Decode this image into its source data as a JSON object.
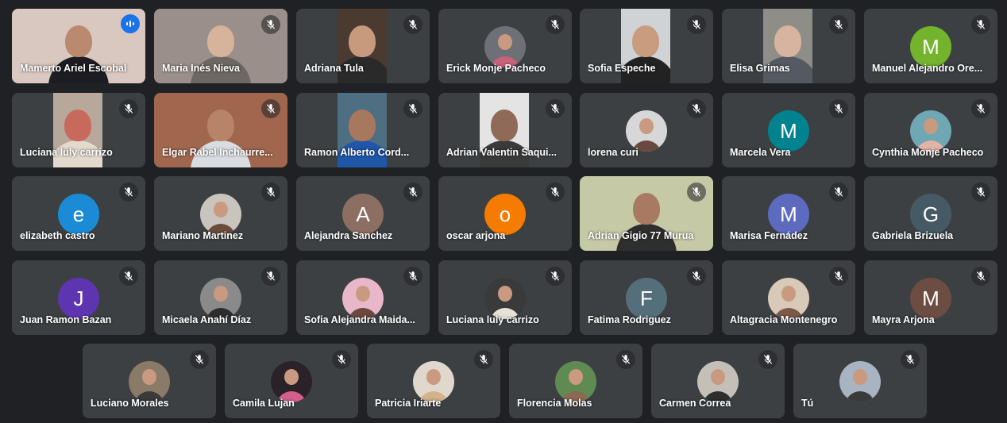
{
  "colors": {
    "background": "#202124",
    "tile": "#3c4043",
    "speaking_border": "#8ab4f8",
    "speaking_badge": "#1a73e8"
  },
  "participants": [
    {
      "name": "Mamerto Ariel Escobal",
      "kind": "video",
      "speaking": true,
      "muted": false,
      "video_bg": "#d9c8c0",
      "video_skin": "#b98a6e",
      "video_cloth": "#1c1c22"
    },
    {
      "name": "Maria Inés Nieva",
      "kind": "video",
      "muted": true,
      "video_bg": "#9a8f8a",
      "video_skin": "#d8b39b",
      "video_cloth": "#6e6863"
    },
    {
      "name": "Adriana Tula",
      "kind": "video",
      "muted": true,
      "video_bg": "#4a3a30",
      "video_skin": "#c79a7e",
      "video_cloth": "#2a2a2a"
    },
    {
      "name": "Erick Monje Pacheco",
      "kind": "photo",
      "muted": true,
      "photo_bg": "#6e7078",
      "photo_fg": "#c8627a"
    },
    {
      "name": "Sofia Espeche",
      "kind": "video",
      "muted": true,
      "video_bg": "#cfd3d6",
      "video_skin": "#c99c80",
      "video_cloth": "#222222"
    },
    {
      "name": "Elisa Grimas",
      "kind": "video",
      "muted": true,
      "video_bg": "#8f8d88",
      "video_skin": "#d6b4a0",
      "video_cloth": "#555a62"
    },
    {
      "name": "Manuel Alejandro Ore...",
      "kind": "letter",
      "muted": true,
      "letter": "M",
      "avatar_color": "#74b32c"
    },
    {
      "name": "Luciana luly carrizo",
      "kind": "video",
      "muted": true,
      "video_bg": "#b8a89c",
      "video_skin": "#c76a5c",
      "video_cloth": "#e3d9cc"
    },
    {
      "name": "Elgar Rabel Inchaurre...",
      "kind": "video",
      "muted": true,
      "video_bg": "#a0664e",
      "video_skin": "#b88468",
      "video_cloth": "#d9dde2"
    },
    {
      "name": "Ramon Alberto Cord...",
      "kind": "video",
      "muted": true,
      "video_bg": "#4e6e82",
      "video_skin": "#a8785e",
      "video_cloth": "#1f56a8"
    },
    {
      "name": "Adrian Valentin Saqui...",
      "kind": "video",
      "muted": true,
      "video_bg": "#e4e4e4",
      "video_skin": "#8f6a58",
      "video_cloth": "#3a3a3a"
    },
    {
      "name": "lorena curi",
      "kind": "photo",
      "muted": true,
      "photo_bg": "#d7d7da",
      "photo_fg": "#6a4a3e"
    },
    {
      "name": "Marcela Vera",
      "kind": "letter",
      "muted": true,
      "letter": "M",
      "avatar_color": "#00838f"
    },
    {
      "name": "Cynthia Monje Pacheco",
      "kind": "photo",
      "muted": true,
      "photo_bg": "#6fa7b4",
      "photo_fg": "#e2b3a6"
    },
    {
      "name": "elizabeth castro",
      "kind": "letter",
      "muted": true,
      "letter": "e",
      "avatar_color": "#1b8bd6"
    },
    {
      "name": "Mariano Martinez",
      "kind": "photo",
      "muted": true,
      "photo_bg": "#c9c4be",
      "photo_fg": "#6b4b3a"
    },
    {
      "name": "Alejandra Sanchez",
      "kind": "letter",
      "muted": true,
      "letter": "A",
      "avatar_color": "#8d6e63"
    },
    {
      "name": "oscar arjona",
      "kind": "letter",
      "muted": true,
      "letter": "o",
      "avatar_color": "#f57c00"
    },
    {
      "name": "Adrian Gigio 77 Murua",
      "kind": "video",
      "muted": true,
      "video_bg": "#c6c9a6",
      "video_skin": "#a87a62",
      "video_cloth": "#2e2e2e"
    },
    {
      "name": "Marisa Fernádez",
      "kind": "letter",
      "muted": true,
      "letter": "M",
      "avatar_color": "#5c6bc0"
    },
    {
      "name": "Gabriela Brizuela",
      "kind": "letter",
      "muted": true,
      "letter": "G",
      "avatar_color": "#455a64"
    },
    {
      "name": "Juan Ramon Bazan",
      "kind": "letter",
      "muted": true,
      "letter": "J",
      "avatar_color": "#5e35b1"
    },
    {
      "name": "Micaela Anahí Díaz",
      "kind": "photo",
      "muted": true,
      "photo_bg": "#8a8a8a",
      "photo_fg": "#2d2d2d"
    },
    {
      "name": "Sofia Alejandra Maida...",
      "kind": "photo",
      "muted": true,
      "photo_bg": "#e8b7c9",
      "photo_fg": "#6a4a3e"
    },
    {
      "name": "Luciana luly carrizo",
      "kind": "photo",
      "muted": true,
      "photo_bg": "#3a3a3a",
      "photo_fg": "#e8e2d6"
    },
    {
      "name": "Fatima Rodriguez",
      "kind": "letter",
      "muted": true,
      "letter": "F",
      "avatar_color": "#546e7a"
    },
    {
      "name": "Altagracia Montenegro",
      "kind": "photo",
      "muted": true,
      "photo_bg": "#d8c9b8",
      "photo_fg": "#7a5a48"
    },
    {
      "name": "Mayra Arjona",
      "kind": "letter",
      "muted": true,
      "letter": "M",
      "avatar_color": "#6d4c41"
    },
    {
      "name": "Luciano Morales",
      "kind": "photo",
      "muted": true,
      "photo_bg": "#8a7a68",
      "photo_fg": "#3a3a3a"
    },
    {
      "name": "Camila Lujan",
      "kind": "photo",
      "muted": true,
      "photo_bg": "#2a2228",
      "photo_fg": "#d35f8e"
    },
    {
      "name": "Patricia Iriarte",
      "kind": "photo",
      "muted": true,
      "photo_bg": "#e0d8cc",
      "photo_fg": "#d4b28a"
    },
    {
      "name": "Florencia Molas",
      "kind": "photo",
      "muted": true,
      "photo_bg": "#5f8a52",
      "photo_fg": "#8a6a52"
    },
    {
      "name": "Carmen Correa",
      "kind": "photo",
      "muted": true,
      "photo_bg": "#c4c0b8",
      "photo_fg": "#2e2e2e"
    },
    {
      "name": "Tú",
      "kind": "photo",
      "muted": true,
      "photo_bg": "#a8b4c2",
      "photo_fg": "#3a3a3a"
    }
  ]
}
